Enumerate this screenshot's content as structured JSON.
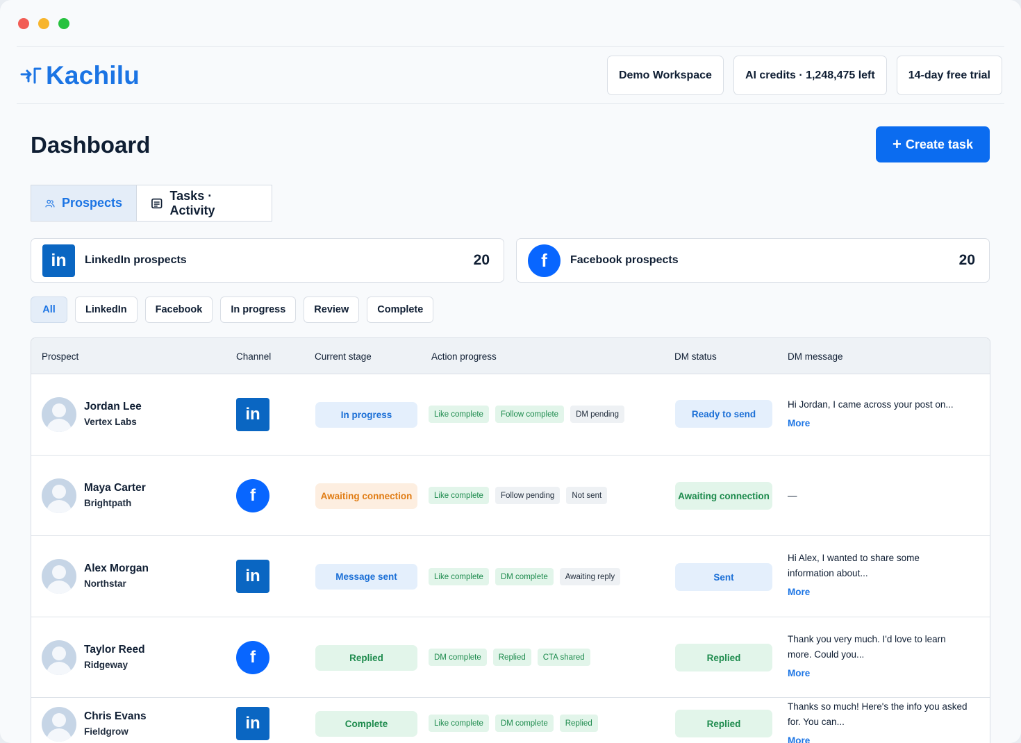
{
  "app": {
    "logo_text": "Kachilu",
    "workspace": "Demo Workspace",
    "credits": "AI credits · 1,248,475 left",
    "trial": "14-day free trial"
  },
  "page": {
    "title": "Dashboard",
    "create_button": "Create task",
    "create_plus": "+"
  },
  "tabs": [
    {
      "label": "Prospects",
      "active": true
    },
    {
      "label": "Tasks · Activity",
      "active": false
    }
  ],
  "sources": {
    "linkedin": {
      "label": "LinkedIn prospects",
      "count": "20",
      "glyph": "in"
    },
    "facebook": {
      "label": "Facebook prospects",
      "count": "20",
      "glyph": "f"
    }
  },
  "filters": [
    "All",
    "LinkedIn",
    "Facebook",
    "In progress",
    "Review",
    "Complete"
  ],
  "table": {
    "headers": [
      "Prospect",
      "Channel",
      "Current stage",
      "Action progress",
      "DM status",
      "DM message"
    ],
    "rows": [
      {
        "name": "Jordan Lee",
        "company": "Vertex Labs",
        "channel": "in",
        "stage": "In progress",
        "actions": [
          "Like complete",
          "Follow complete",
          "DM pending"
        ],
        "dm_status": "Ready to send",
        "message": "Hi Jordan, I came across your post on...",
        "more": "More"
      },
      {
        "name": "Maya Carter",
        "company": "Brightpath",
        "channel": "f",
        "stage": "Awaiting connection",
        "actions": [
          "Like complete",
          "Follow pending",
          "Not sent"
        ],
        "dm_status": "Awaiting connection",
        "message": "—",
        "more": ""
      },
      {
        "name": "Alex Morgan",
        "company": "Northstar",
        "channel": "in",
        "stage": "Message sent",
        "actions": [
          "Like complete",
          "DM complete",
          "Awaiting reply"
        ],
        "dm_status": "Sent",
        "message": "Hi Alex, I wanted to share some information about...",
        "more": "More"
      },
      {
        "name": "Taylor Reed",
        "company": "Ridgeway",
        "channel": "f",
        "stage": "Replied",
        "actions": [
          "DM complete",
          "Replied",
          "CTA shared"
        ],
        "dm_status": "Replied",
        "message": "Thank you very much. I'd love to learn more. Could you...",
        "more": "More"
      },
      {
        "name": "Chris Evans",
        "company": "Fieldgrow",
        "channel": "in",
        "stage": "Complete",
        "actions": [
          "Like complete",
          "DM complete",
          "Replied"
        ],
        "dm_status": "Replied",
        "message": "Thanks so much! Here's the info you asked for. You can...",
        "more": "More"
      }
    ]
  }
}
